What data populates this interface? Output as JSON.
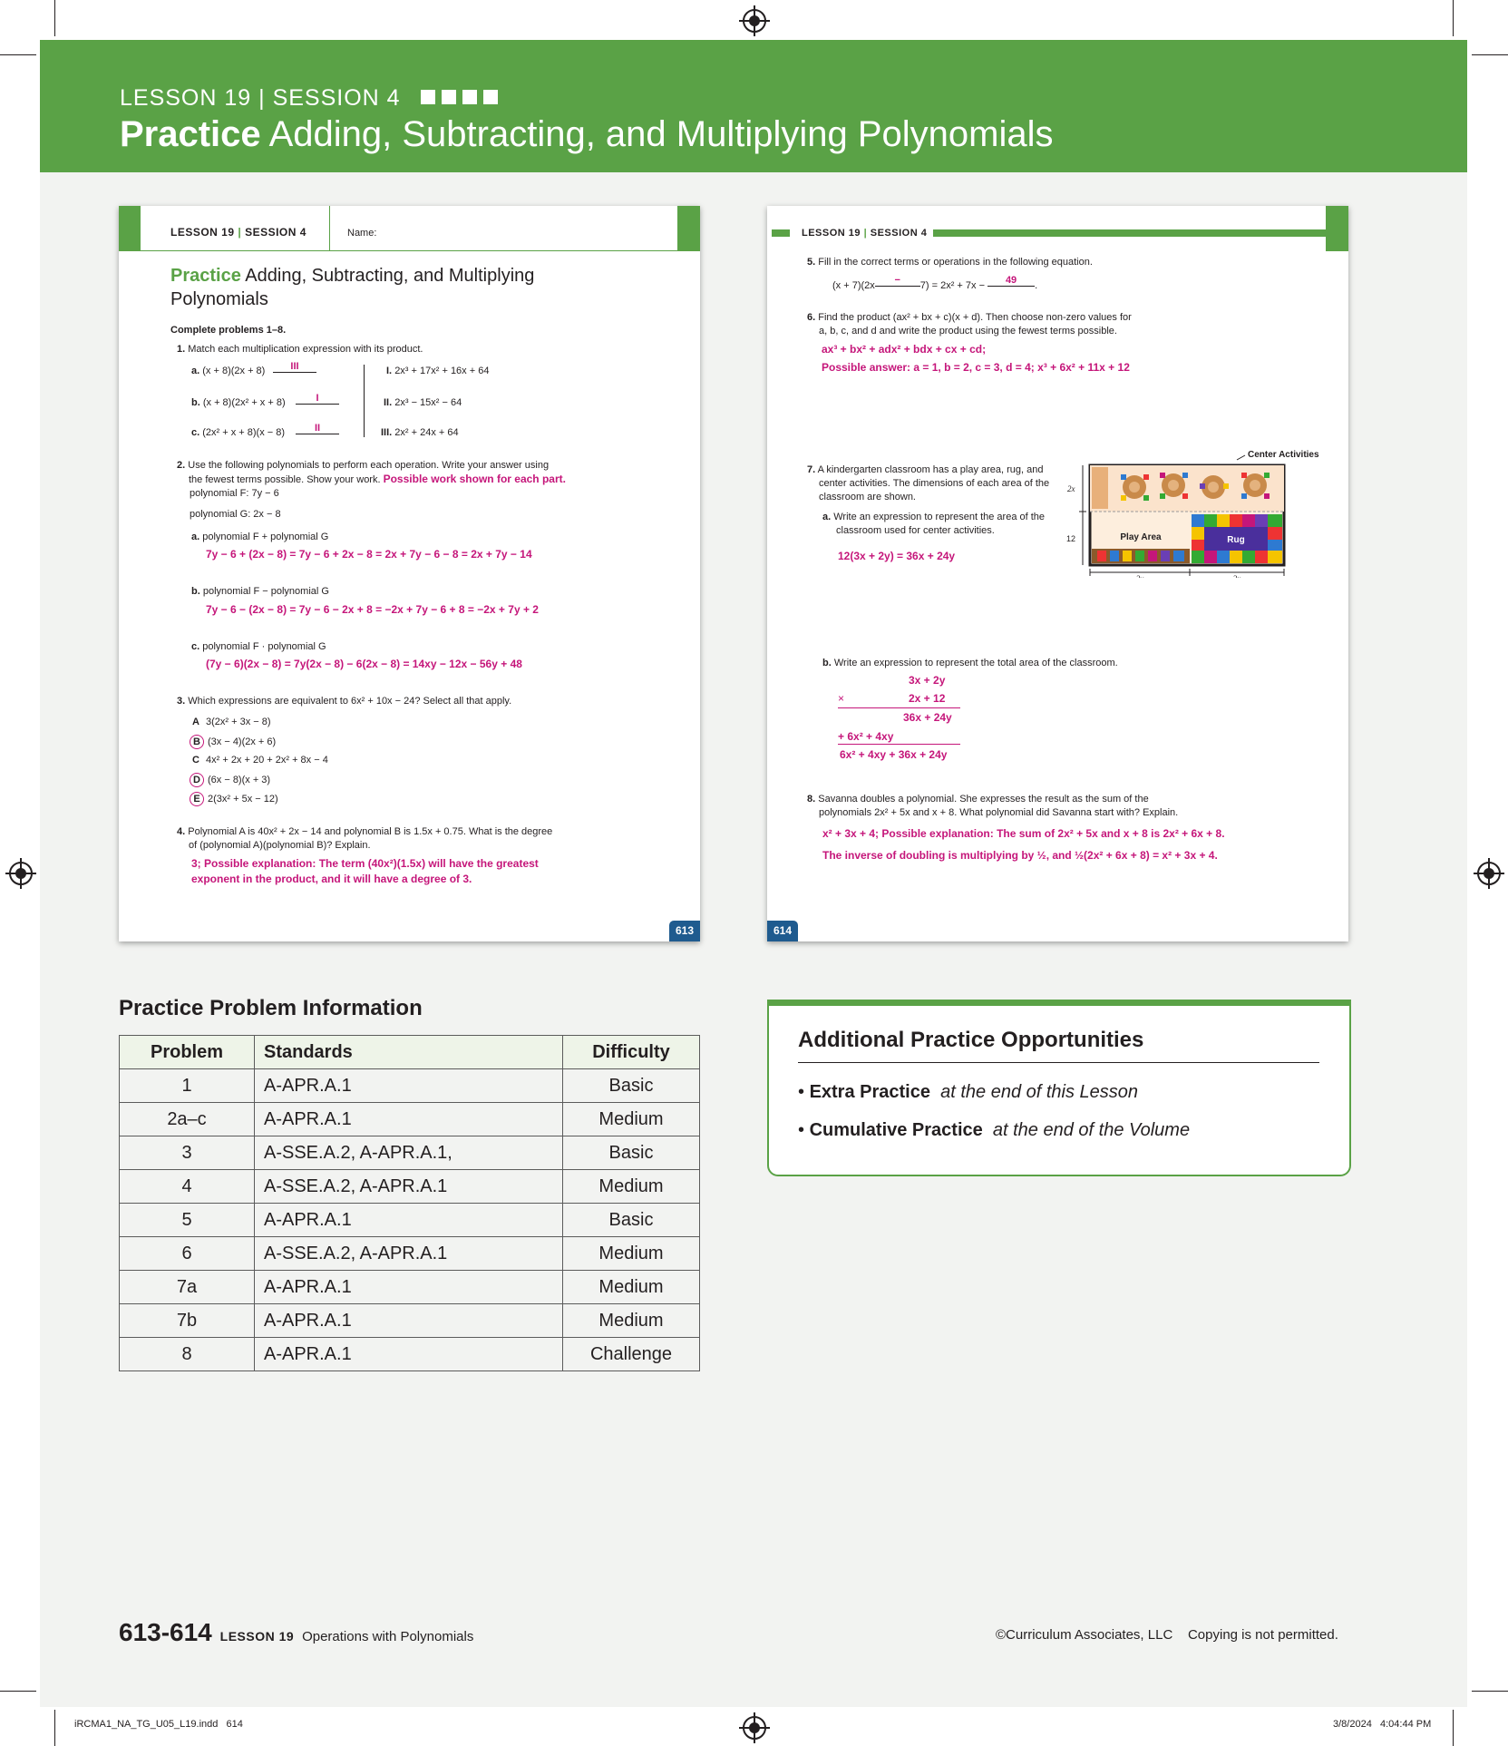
{
  "banner": {
    "kicker": "LESSON 19 | SESSION 4",
    "title_bold": "Practice",
    "title_rest": " Adding, Subtracting, and Multiplying Polynomials"
  },
  "left_page": {
    "header_lesson": "LESSON 19",
    "header_session": "SESSION 4",
    "name_label": "Name:",
    "title_bold": "Practice",
    "title_line1": " Adding, Subtracting, and Multiplying",
    "title_line2": "Polynomials",
    "instructions": "Complete problems 1–8.",
    "p1": {
      "num": "1.",
      "prompt": "Match each multiplication expression with its product.",
      "a": "a.",
      "a_expr": "(x + 8)(2x + 8)",
      "a_ans": "III",
      "b": "b.",
      "b_expr": "(x + 8)(2x² + x + 8)",
      "b_ans": "I",
      "c": "c.",
      "c_expr": "(2x² + x + 8)(x − 8)",
      "c_ans": "II",
      "i": "I.",
      "i_expr": "2x³ + 17x² + 16x + 64",
      "ii": "II.",
      "ii_expr": "2x³ − 15x² − 64",
      "iii": "III.",
      "iii_expr": "2x² + 24x + 64"
    },
    "p2": {
      "num": "2.",
      "prompt1": "Use the following polynomials to perform each operation. Write your answer using",
      "prompt2": "the fewest terms possible. Show your work.",
      "note": "Possible work shown for each part.",
      "polyF": "polynomial F: 7y − 6",
      "polyG": "polynomial G: 2x − 8",
      "a_label": "a.",
      "a_q": "polynomial F + polynomial G",
      "a_ans": "7y − 6 + (2x − 8) = 7y − 6 + 2x − 8 = 2x + 7y − 6 − 8 = 2x + 7y − 14",
      "b_label": "b.",
      "b_q": "polynomial F − polynomial G",
      "b_ans": "7y − 6 − (2x − 8) = 7y − 6 − 2x + 8 = −2x + 7y − 6 + 8 = −2x + 7y + 2",
      "c_label": "c.",
      "c_q": "polynomial F · polynomial G",
      "c_ans": "(7y − 6)(2x − 8) = 7y(2x − 8) − 6(2x − 8) = 14xy − 12x − 56y + 48"
    },
    "p3": {
      "num": "3.",
      "prompt": "Which expressions are equivalent to 6x² + 10x − 24? Select all that apply.",
      "options": [
        {
          "letter": "A",
          "expr": "3(2x² + 3x − 8)",
          "circled": false
        },
        {
          "letter": "B",
          "expr": "(3x − 4)(2x + 6)",
          "circled": true
        },
        {
          "letter": "C",
          "expr": "4x² + 2x + 20 + 2x² + 8x − 4",
          "circled": false
        },
        {
          "letter": "D",
          "expr": "(6x − 8)(x + 3)",
          "circled": true
        },
        {
          "letter": "E",
          "expr": "2(3x² + 5x − 12)",
          "circled": true
        }
      ]
    },
    "p4": {
      "num": "4.",
      "prompt1": "Polynomial A is 40x² + 2x − 14 and polynomial B is 1.5x + 0.75. What is the degree",
      "prompt2": "of (polynomial A)(polynomial B)? Explain.",
      "ans1": "3; Possible explanation: The term (40x²)(1.5x) will have the greatest",
      "ans2": "exponent in the product, and it will have a degree of 3."
    },
    "page_num": "613"
  },
  "right_page": {
    "header_lesson": "LESSON 19",
    "header_session": "SESSION 4",
    "p5": {
      "num": "5.",
      "prompt": "Fill in the correct terms or operations in the following equation.",
      "eq_start": "(x + 7)(2x",
      "blank1": "−",
      "eq_mid": "7) = 2x² + 7x −",
      "blank2": "49",
      "eq_end": "."
    },
    "p6": {
      "num": "6.",
      "prompt1": "Find the product (ax² + bx + c)(x + d). Then choose non-zero values for",
      "prompt2": "a, b, c, and d and write the product using the fewest terms possible.",
      "ans1": "ax³ + bx² + adx² + bdx + cx + cd;",
      "ans2": "Possible answer: a = 1, b = 2, c = 3, d = 4; x³ + 6x² + 11x + 12"
    },
    "p7": {
      "num": "7.",
      "prompt1": "A kindergarten classroom has a play area, rug, and",
      "prompt2": "center activities. The dimensions of each area of the",
      "prompt3": "classroom are shown.",
      "a_label": "a.",
      "a_q1": "Write an expression to represent the area of the",
      "a_q2": "classroom used for center activities.",
      "a_ans": "12(3x + 2y) = 36x + 24y",
      "diagram": {
        "callout": "Center Activities",
        "play_area": "Play Area",
        "rug": "Rug",
        "dim_2x": "2x",
        "dim_12": "12",
        "dim_2y": "2y",
        "dim_3x": "3x"
      },
      "b_label": "b.",
      "b_q": "Write an expression to represent the total area of the classroom.",
      "b_line1": "3x + 2y",
      "b_times": "×",
      "b_line2": "2x + 12",
      "b_line3": "36x + 24y",
      "b_line4": "+ 6x² + 4xy",
      "b_line5": "6x² + 4xy + 36x + 24y"
    },
    "p8": {
      "num": "8.",
      "prompt1": "Savanna doubles a polynomial. She expresses the result as the sum of the",
      "prompt2": "polynomials 2x² + 5x and x + 8. What polynomial did Savanna start with? Explain.",
      "ans1": "x² + 3x + 4; Possible explanation: The sum of 2x² + 5x and x + 8 is 2x² + 6x + 8.",
      "ans2": "The inverse of doubling is multiplying by ½, and ½(2x² + 6x + 8) = x² + 3x + 4."
    },
    "page_num": "614"
  },
  "practice_info": {
    "heading": "Practice Problem Information",
    "columns": [
      "Problem",
      "Standards",
      "Difficulty"
    ],
    "rows": [
      [
        "1",
        "A-APR.A.1",
        "Basic"
      ],
      [
        "2a–c",
        "A-APR.A.1",
        "Medium"
      ],
      [
        "3",
        "A-SSE.A.2, A-APR.A.1,",
        "Basic"
      ],
      [
        "4",
        "A-SSE.A.2, A-APR.A.1",
        "Medium"
      ],
      [
        "5",
        "A-APR.A.1",
        "Basic"
      ],
      [
        "6",
        "A-SSE.A.2, A-APR.A.1",
        "Medium"
      ],
      [
        "7a",
        "A-APR.A.1",
        "Medium"
      ],
      [
        "7b",
        "A-APR.A.1",
        "Medium"
      ],
      [
        "8",
        "A-APR.A.1",
        "Challenge"
      ]
    ]
  },
  "additional": {
    "heading": "Additional Practice Opportunities",
    "items": [
      {
        "bold": "Extra Practice",
        "italic": "at the end of this Lesson"
      },
      {
        "bold": "Cumulative Practice",
        "italic": "at the end of the Volume"
      }
    ]
  },
  "footer": {
    "pages": "613-614",
    "lesson": "LESSON 19",
    "topic": "Operations with Polynomials",
    "copyright": "©Curriculum Associates, LLC",
    "copy_note": "Copying is not permitted."
  },
  "slug": {
    "file": "iRCMA1_NA_TG_U05_L19.indd   614",
    "date": "3/8/2024   4:04:44 PM"
  },
  "colors": {
    "green": "#5aa246",
    "magenta": "#c5167a",
    "blue": "#1f5b8f"
  }
}
